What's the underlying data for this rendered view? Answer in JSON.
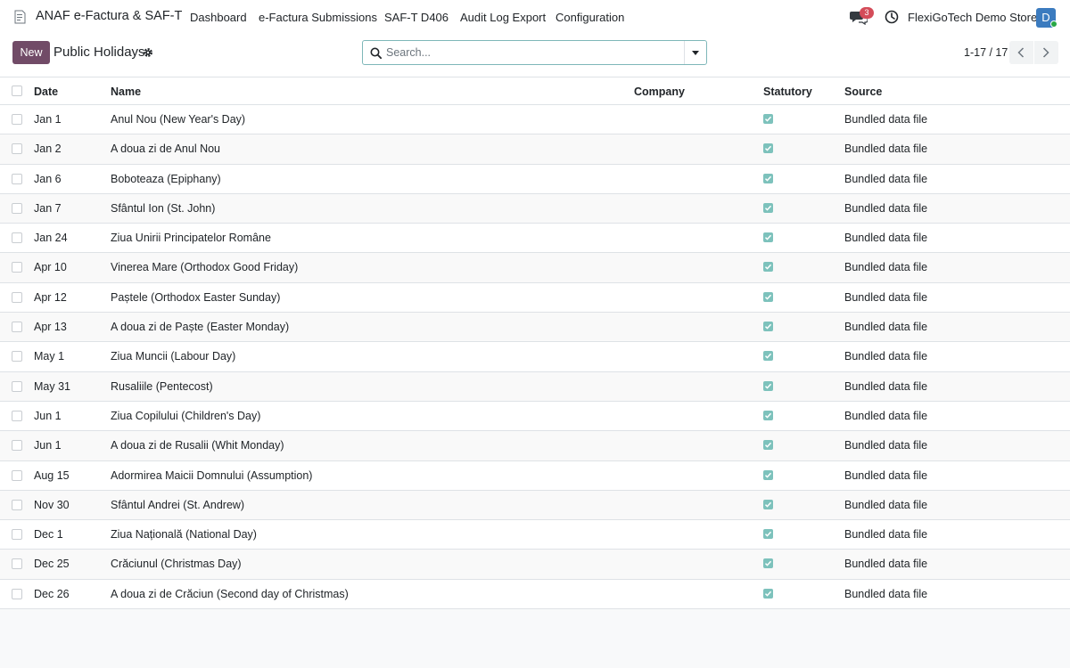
{
  "navbar": {
    "brand": "ANAF e-Factura & SAF-T",
    "menus": [
      "Dashboard",
      "e-Factura Submissions",
      "SAF-T D406",
      "Audit Log Export",
      "Configuration"
    ],
    "chat_badge": "3",
    "company": "FlexiGoTech Demo Store",
    "avatar_letter": "D"
  },
  "control_panel": {
    "new_button": "New",
    "title": "Public Holidays",
    "search_placeholder": "Search...",
    "pager": "1-17 / 17"
  },
  "list": {
    "columns": [
      "Date",
      "Name",
      "Company",
      "Statutory",
      "Source"
    ],
    "rows": [
      {
        "date": "Jan 1",
        "name": "Anul Nou (New Year's Day)",
        "company": "",
        "statutory": true,
        "source": "Bundled data file"
      },
      {
        "date": "Jan 2",
        "name": "A doua zi de Anul Nou",
        "company": "",
        "statutory": true,
        "source": "Bundled data file"
      },
      {
        "date": "Jan 6",
        "name": "Boboteaza (Epiphany)",
        "company": "",
        "statutory": true,
        "source": "Bundled data file"
      },
      {
        "date": "Jan 7",
        "name": "Sfântul Ion (St. John)",
        "company": "",
        "statutory": true,
        "source": "Bundled data file"
      },
      {
        "date": "Jan 24",
        "name": "Ziua Unirii Principatelor Române",
        "company": "",
        "statutory": true,
        "source": "Bundled data file"
      },
      {
        "date": "Apr 10",
        "name": "Vinerea Mare (Orthodox Good Friday)",
        "company": "",
        "statutory": true,
        "source": "Bundled data file"
      },
      {
        "date": "Apr 12",
        "name": "Paștele (Orthodox Easter Sunday)",
        "company": "",
        "statutory": true,
        "source": "Bundled data file"
      },
      {
        "date": "Apr 13",
        "name": "A doua zi de Paște (Easter Monday)",
        "company": "",
        "statutory": true,
        "source": "Bundled data file"
      },
      {
        "date": "May 1",
        "name": "Ziua Muncii (Labour Day)",
        "company": "",
        "statutory": true,
        "source": "Bundled data file"
      },
      {
        "date": "May 31",
        "name": "Rusaliile (Pentecost)",
        "company": "",
        "statutory": true,
        "source": "Bundled data file"
      },
      {
        "date": "Jun 1",
        "name": "Ziua Copilului (Children's Day)",
        "company": "",
        "statutory": true,
        "source": "Bundled data file"
      },
      {
        "date": "Jun 1",
        "name": "A doua zi de Rusalii (Whit Monday)",
        "company": "",
        "statutory": true,
        "source": "Bundled data file"
      },
      {
        "date": "Aug 15",
        "name": "Adormirea Maicii Domnului (Assumption)",
        "company": "",
        "statutory": true,
        "source": "Bundled data file"
      },
      {
        "date": "Nov 30",
        "name": "Sfântul Andrei (St. Andrew)",
        "company": "",
        "statutory": true,
        "source": "Bundled data file"
      },
      {
        "date": "Dec 1",
        "name": "Ziua Națională (National Day)",
        "company": "",
        "statutory": true,
        "source": "Bundled data file"
      },
      {
        "date": "Dec 25",
        "name": "Crăciunul (Christmas Day)",
        "company": "",
        "statutory": true,
        "source": "Bundled data file"
      },
      {
        "date": "Dec 26",
        "name": "A doua zi de Crăciun (Second day of Christmas)",
        "company": "",
        "statutory": true,
        "source": "Bundled data file"
      }
    ]
  },
  "colors": {
    "brand_button": "#714b67",
    "statutory_check": "#7dc2bc",
    "search_border": "#7eb7b9",
    "badge": "#d44c59",
    "avatar": "#3b7bbf"
  }
}
